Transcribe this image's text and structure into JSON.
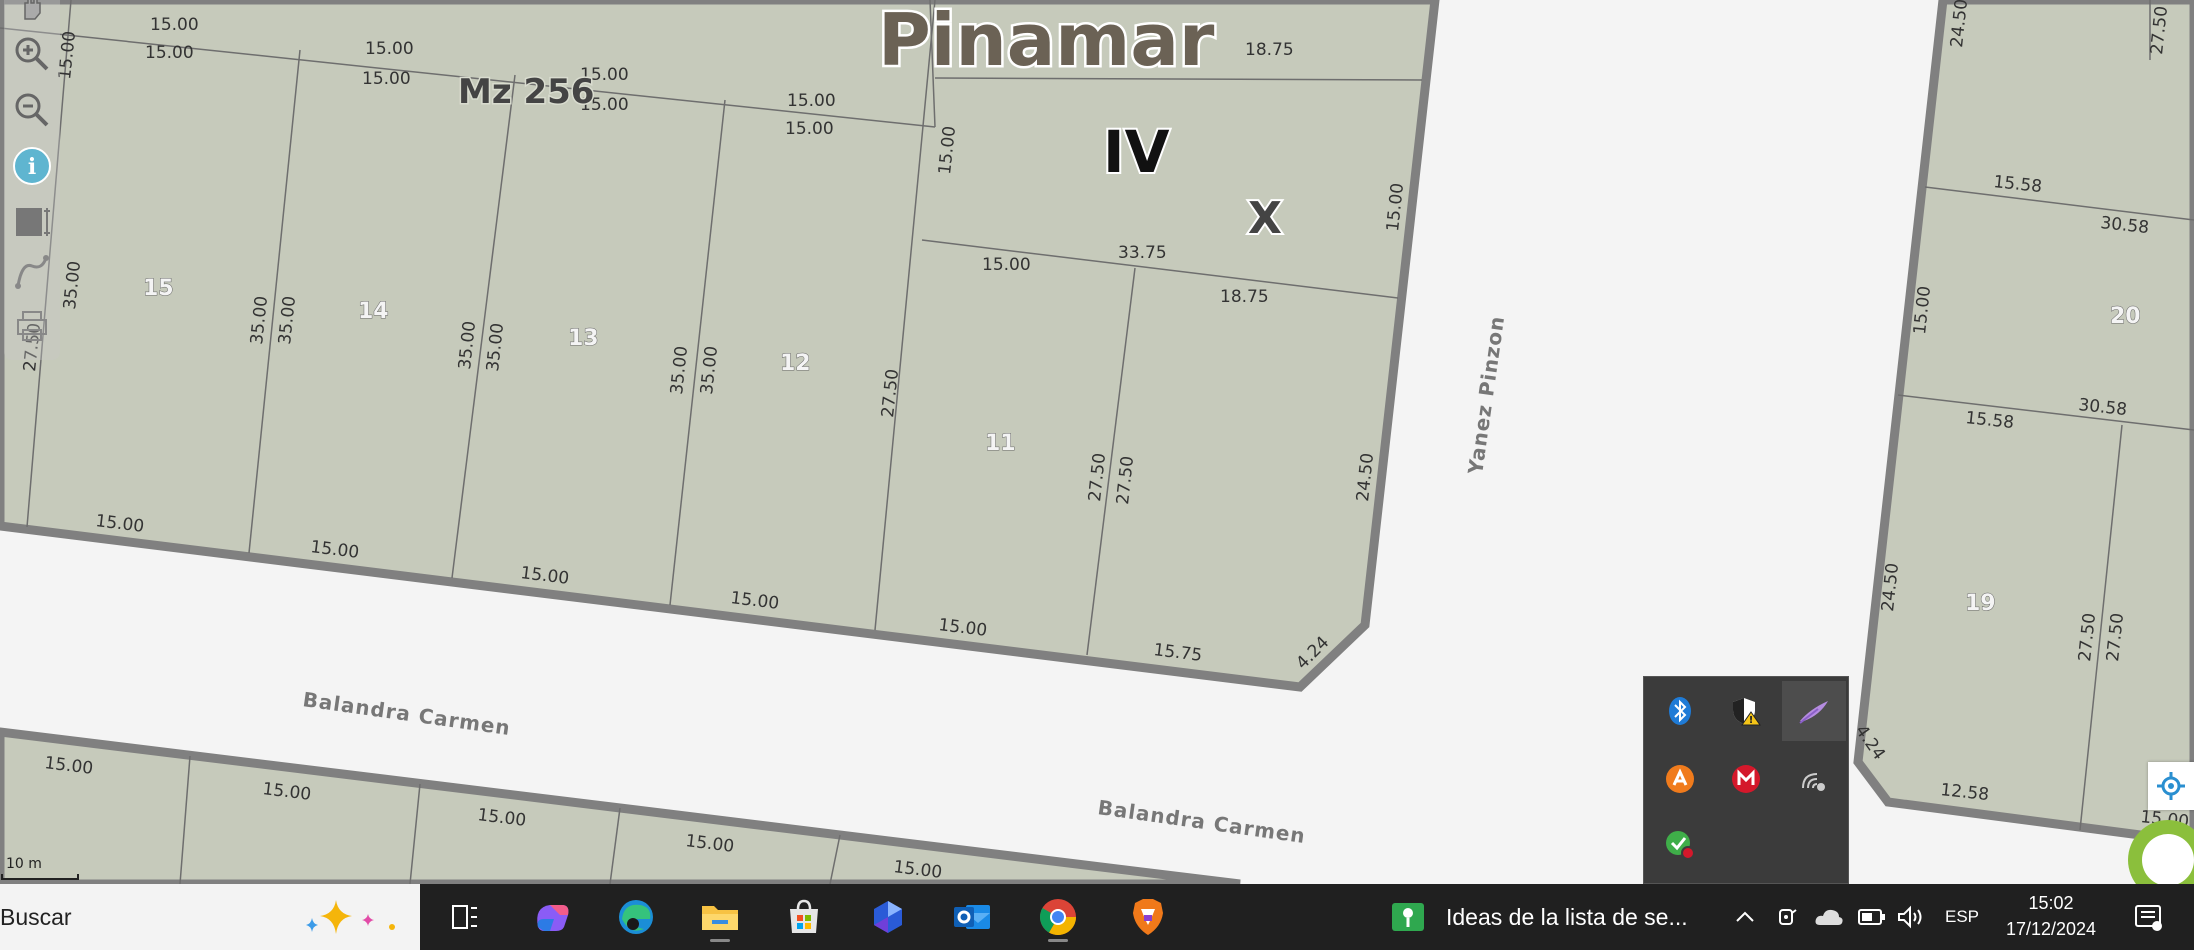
{
  "map": {
    "town_label": "Pinamar",
    "block_label": "Mz 256",
    "section_label": "IV",
    "circ_label": "X",
    "streets": [
      "Yanez Pinzon",
      "Balandra Carmen",
      "Balandra Carmen"
    ],
    "lots": [
      "15",
      "14",
      "13",
      "12",
      "11",
      "20",
      "19"
    ],
    "measures": {
      "top_a": [
        "15.00",
        "15.00",
        "15.00",
        "15.00",
        "15.00",
        "15.00",
        "15.00",
        "15.00",
        "15.00"
      ],
      "top_b": [
        "18.75",
        "15.00",
        "33.75",
        "18.75",
        "15.00"
      ],
      "side": [
        "15.00",
        "27.50",
        "35.00",
        "35.00",
        "35.00",
        "35.00",
        "35.00",
        "35.00",
        "35.00",
        "27.50",
        "27.50",
        "27.50",
        "24.50"
      ],
      "bottom": [
        "15.00",
        "15.00",
        "15.00",
        "15.00",
        "15.00",
        "15.75",
        "4.24"
      ],
      "lower_block": [
        "15.00",
        "15.00",
        "15.00",
        "15.00",
        "15.00"
      ],
      "right_block": [
        "24.50",
        "27.50",
        "15.58",
        "30.58",
        "15.00",
        "15.58",
        "30.58",
        "24.50",
        "27.50",
        "27.50",
        "4.24",
        "12.58",
        "15.00"
      ]
    },
    "scale_label": "10 m"
  },
  "toolbar": {
    "tools": [
      "pan-hand-icon",
      "zoom-in-icon",
      "zoom-out-icon",
      "info-icon",
      "select-area-icon",
      "measure-icon",
      "print-icon"
    ]
  },
  "tray_popup": {
    "icons": [
      "bluetooth-icon",
      "security-warning-icon",
      "pen-feather-icon",
      "avast-icon",
      "mcafee-icon",
      "wifi-sync-icon",
      "check-green-icon"
    ]
  },
  "taskbar": {
    "search_label": "Buscar",
    "apps": [
      "task-view-icon",
      "copilot-icon",
      "edge-icon",
      "file-explorer-icon",
      "store-icon",
      "power-bi-icon",
      "outlook-icon",
      "chrome-icon",
      "brave-icon"
    ],
    "notification_text": "Ideas de la lista de se...",
    "language": "ESP",
    "time": "15:02",
    "date": "17/12/2024"
  },
  "colors": {
    "parcel_fill": "#c6cabb",
    "parcel_border": "#808080",
    "street_bg": "#f4f4f4",
    "taskbar_bg": "#202020"
  }
}
